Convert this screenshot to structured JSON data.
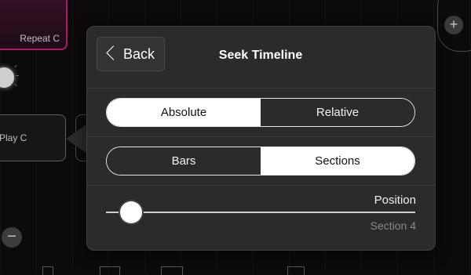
{
  "background": {
    "repeat_pad_label": "Repeat C",
    "play_pad_label": "Play C",
    "minus_glyph": "−",
    "plus_glyph": "+",
    "accent_color": "#b0176a"
  },
  "popover": {
    "back_label": "Back",
    "title": "Seek Timeline",
    "mode_segment": {
      "options": [
        "Absolute",
        "Relative"
      ],
      "selected": "Absolute"
    },
    "unit_segment": {
      "options": [
        "Bars",
        "Sections"
      ],
      "selected": "Sections"
    },
    "position": {
      "label": "Position",
      "value_text": "Section 4",
      "slider_fraction": 0.08
    }
  }
}
